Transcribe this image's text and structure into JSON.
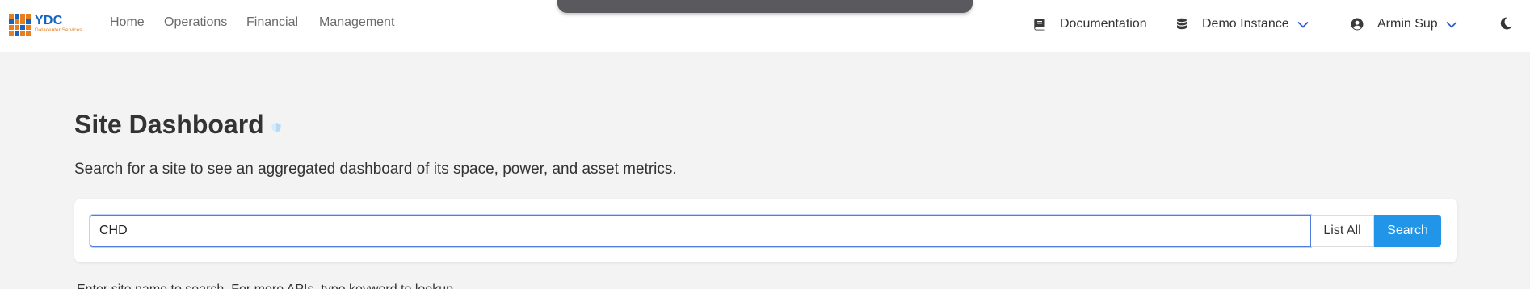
{
  "brand": {
    "name": "YDC",
    "tagline": "Datacenter Services",
    "colors": {
      "primary": "#1565c0",
      "accent": "#e67e22"
    }
  },
  "nav": {
    "links": [
      "Home",
      "Operations",
      "Financial",
      "Management"
    ]
  },
  "header_right": {
    "documentation": {
      "label": "Documentation",
      "icon": "book-icon"
    },
    "instance": {
      "label": "Demo Instance",
      "icon": "database-icon"
    },
    "user": {
      "label": "Armin Sup",
      "icon": "user-circle-icon"
    },
    "theme_toggle": {
      "icon": "moon-icon"
    }
  },
  "page": {
    "title": "Site Dashboard",
    "description": "Search for a site to see an aggregated dashboard of its space, power, and asset metrics."
  },
  "search": {
    "value": "CHD",
    "list_all_label": "List All",
    "search_label": "Search",
    "button_color": "#2196e8"
  },
  "hint": "Enter site name to search. For more APIs, type keyword to lookup."
}
